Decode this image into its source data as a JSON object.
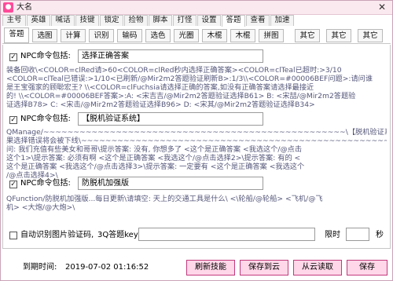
{
  "window": {
    "title": "大名",
    "app_icon": "app-logo-icon",
    "close_glyph": "✕"
  },
  "menu": [
    "主号",
    "英雄",
    "喊话",
    "技键",
    "锁定",
    "捡物",
    "脚本",
    "打怪",
    "设置",
    "答题",
    "查看",
    "加速"
  ],
  "menu_active": "答题",
  "subtabs": [
    "答题",
    "选图",
    "计算",
    "识别",
    "输码",
    "选色",
    "光圈",
    "木棍",
    "木棍",
    "拼图",
    "其它",
    "其它",
    "其它"
  ],
  "subtab_active": "答题",
  "sections": [
    {
      "checked": true,
      "label": "NPC命令包括:",
      "value": "选择正确答案",
      "lines": [
        "装备回收\\<COLOR=clRed请>60<COLOR=clRed秒内选择正确答案><COLOR=clTeal已超时:>3/10",
        "<COLOR=clTeal已错误:>1/10<已刷新/@Mir2m2答题验证刷新B>:1/3\\\\<COLOR=#00006BEF问题>:请问谁",
        "是王宝强家的顾聪宏王? \\\\<COLOR=clFuchsia请选择正确的答案,如没有正确答案请选择最接近",
        "的! \\\\<COLOR=#00006BEF答案>:A: <宋吉吉/@Mir2m2答题验证选择B61>   B: <宋喆/@Mir2m2答题验",
        "证选择B78>   C: <宋击/@Mir2m2答题验证选择B96>   D: <宋其/@Mir2m2答题验证选择B34>"
      ]
    },
    {
      "checked": true,
      "label": "NPC命令包括:",
      "value": "【脱机验证系统】",
      "lines": [
        "QManage/~~~~~~~~~~~~~~~~~~~~~~~~~~~~~~~~~~~~~~~~~~~~~~~~~~\\【脱机验证系统】 Hot^ 如",
        "果选择错误将会被下线\\~~~~~~~~~~~~~~~~~~~~~~~~~~~~~~~~~~~~~~~~~~~~~~~~~~~~~~~\\脱机提",
        "问: 我们充值有些美女和哥哥\\提示答案: 没有, 你想多了  <这个是正确答案  <我选这个/@点击",
        "这个1>\\提示答案: 必须有啊  <这个是正确答案  <我选这个/@点击选择2>\\提示答案: 有的  <",
        "这个是正确答案  <我选这个/@点击选择3>\\提示答案: 一定要有  <这个是正确答案  <我选这个",
        "/@点击选择4>\\"
      ]
    },
    {
      "checked": true,
      "label": "NPC命令包括:",
      "value": "防脱机加强版",
      "lines": [
        "QFunction/防脱机加强版...每日更新\\请填空: 天上的交通工具是什么\\  <\\轮船/@轮船>  <飞机/@飞",
        "机>  <大炮/@大炮>\\"
      ]
    }
  ],
  "auto_recognize": {
    "checked": false,
    "label": "自动识别图片验证码,",
    "key_label": "3Q答题key:",
    "key_value": "",
    "time_label": "限时",
    "time_value": "",
    "unit": "秒"
  },
  "footer": {
    "expire_label": "到期时间:",
    "expire_value": "2019-07-02 01:16:52",
    "buttons": [
      "刷新技能",
      "保存到云",
      "从云读取",
      "保存"
    ]
  },
  "colors": {
    "accent": "#ff4a9a",
    "button_bg": "#ffd7e8",
    "button_border": "#c23a7d",
    "text_gray": "#55577a"
  }
}
